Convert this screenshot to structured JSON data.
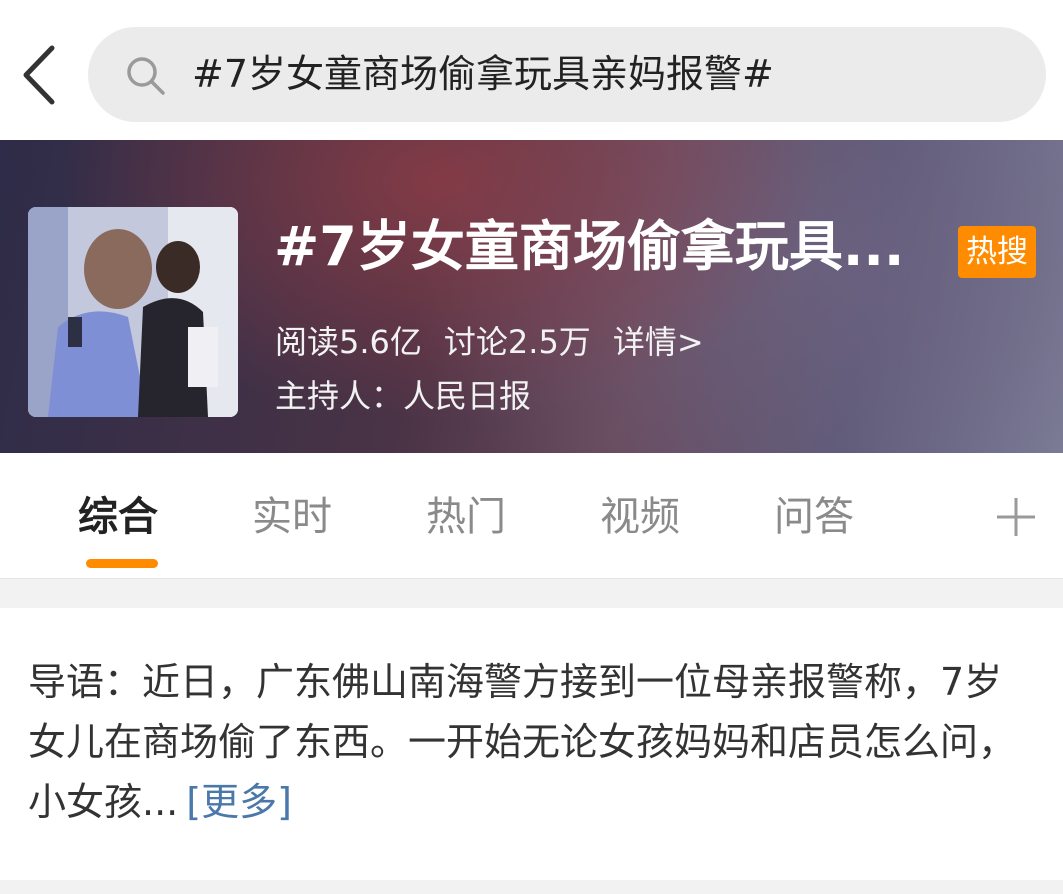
{
  "search": {
    "query": "#7岁女童商场偷拿玩具亲妈报警#"
  },
  "banner": {
    "title": "#7岁女童商场偷拿玩具...",
    "badge": "热搜",
    "reads": "阅读5.6亿",
    "discussions": "讨论2.5万",
    "details": "详情>",
    "host": "主持人：人民日报"
  },
  "tabs": [
    {
      "label": "综合",
      "active": true
    },
    {
      "label": "实时",
      "active": false
    },
    {
      "label": "热门",
      "active": false
    },
    {
      "label": "视频",
      "active": false
    },
    {
      "label": "问答",
      "active": false
    }
  ],
  "intro": {
    "text": "导语：近日，广东佛山南海警方接到一位母亲报警称，7岁女儿在商场偷了东西。一开始无论女孩妈妈和店员怎么问，小女孩...",
    "more": "[更多]"
  },
  "icons": {
    "back": "chevron-left-icon",
    "search": "search-icon",
    "add": "plus-icon"
  },
  "colors": {
    "accent": "#ff8c00",
    "link": "#4a78a8"
  }
}
